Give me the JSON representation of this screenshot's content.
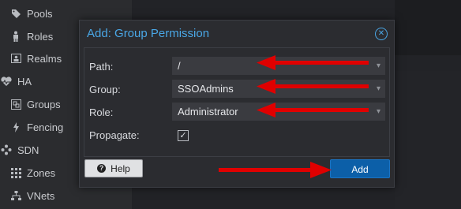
{
  "sidebar": {
    "items": [
      {
        "label": "Pools",
        "icon": "tag-icon"
      },
      {
        "label": "Roles",
        "icon": "person-icon"
      },
      {
        "label": "Realms",
        "icon": "address-card-icon"
      },
      {
        "label": "HA",
        "icon": "heartbeat-icon"
      },
      {
        "label": "Groups",
        "icon": "object-group-icon"
      },
      {
        "label": "Fencing",
        "icon": "bolt-icon"
      },
      {
        "label": "SDN",
        "icon": "sdn-icon"
      },
      {
        "label": "Zones",
        "icon": "grid-icon"
      },
      {
        "label": "VNets",
        "icon": "network-icon"
      }
    ]
  },
  "dialog": {
    "title": "Add: Group Permission",
    "fields": {
      "path": {
        "label": "Path:",
        "value": "/"
      },
      "group": {
        "label": "Group:",
        "value": "SSOAdmins"
      },
      "role": {
        "label": "Role:",
        "value": "Administrator"
      },
      "propagate": {
        "label": "Propagate:",
        "checked": true
      }
    },
    "buttons": {
      "help": "Help",
      "add": "Add"
    }
  },
  "colors": {
    "accent": "#4aa7e6",
    "primary_button": "#0c5fa8",
    "annotation_arrow": "#e00000"
  }
}
